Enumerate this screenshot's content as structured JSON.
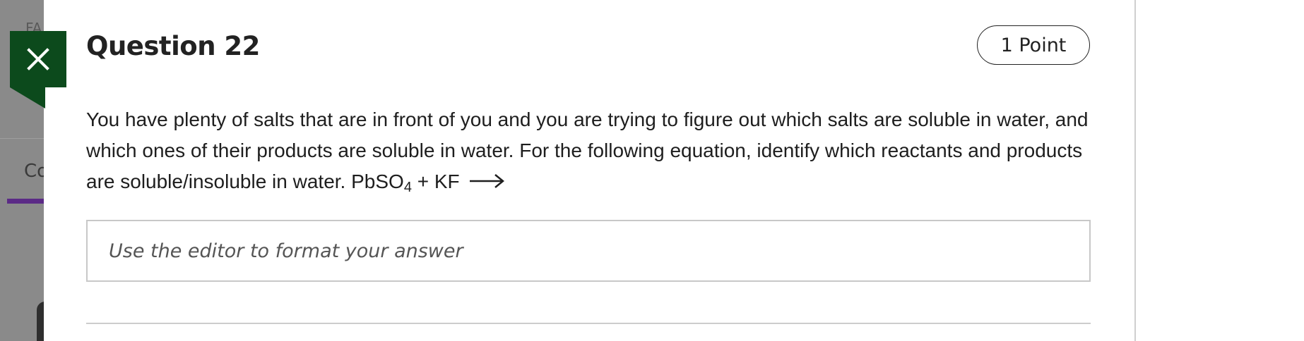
{
  "background": {
    "top_text": "FA",
    "tab_text": "Co"
  },
  "question": {
    "title": "Question 22",
    "points": "1 Point",
    "text_main": "You have plenty of salts that are in front of you and you are trying to figure out which salts are soluble in water, and which ones of their products are soluble in water. For the following equation, identify which reactants and products are soluble/insoluble in water. ",
    "formula_prefix": "PbSO",
    "formula_subscript": "4",
    "formula_suffix": " + KF",
    "arrow_icon": "right-arrow-icon"
  },
  "editor": {
    "placeholder": "Use the editor to format your answer"
  },
  "colors": {
    "close_badge": "#0c4a1c",
    "tab_accent": "#5b2a86"
  }
}
